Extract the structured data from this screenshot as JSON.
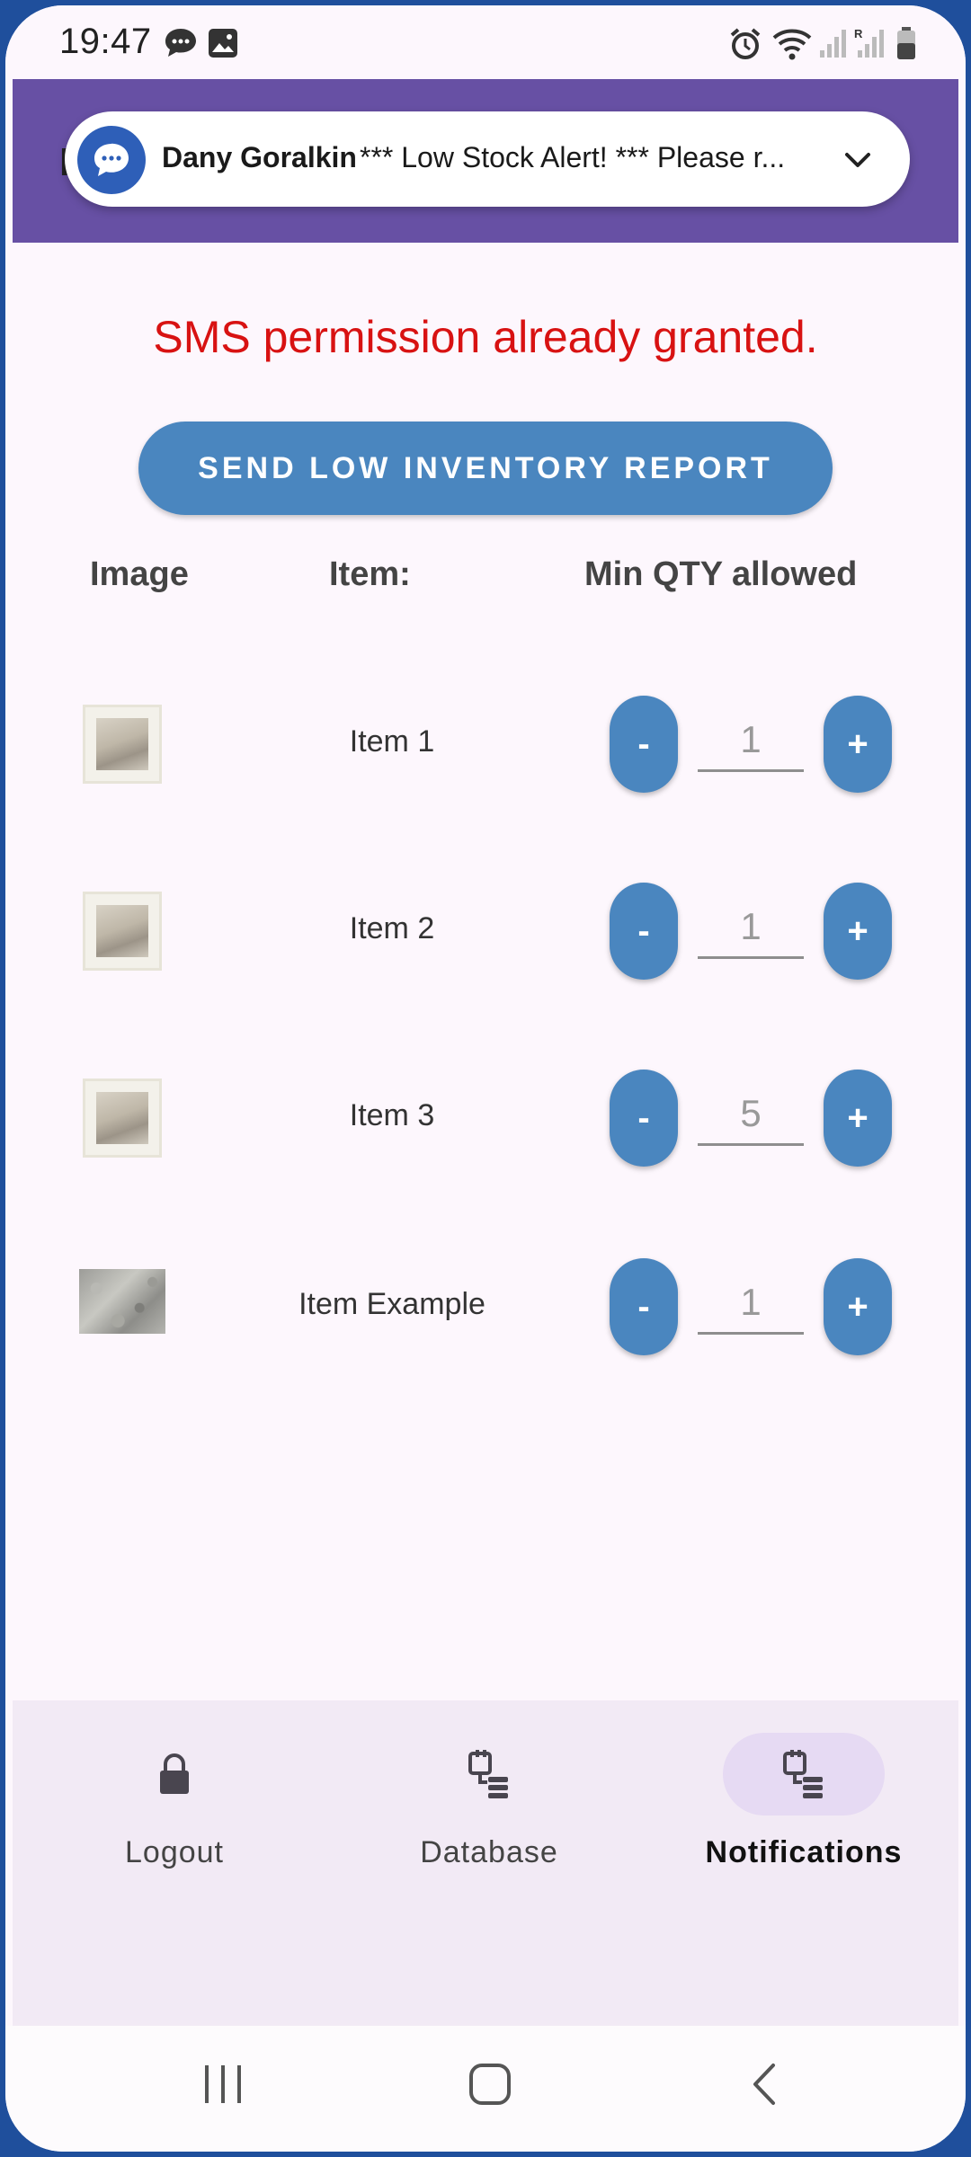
{
  "status_bar": {
    "time": "19:47",
    "icons": [
      "chat-icon",
      "gallery-icon",
      "alarm-icon",
      "wifi-icon",
      "signal-icon",
      "roaming-signal-icon",
      "battery-icon"
    ]
  },
  "app_bar": {
    "title_fragment": "N"
  },
  "notification": {
    "sender": "Dany Goralkin",
    "text": "*** Low Stock Alert! *** Please r...",
    "icon": "message-bubble-icon",
    "expand_icon": "chevron-down-icon"
  },
  "main": {
    "permission_message": "SMS permission already granted.",
    "send_report_label": "SEND LOW INVENTORY REPORT",
    "headers": {
      "image": "Image",
      "item": "Item:",
      "min_qty": "Min QTY allowed"
    },
    "items": [
      {
        "name": "Item 1",
        "qty": "1",
        "image": "framed-photo-thumbnail"
      },
      {
        "name": "Item 2",
        "qty": "1",
        "image": "framed-photo-thumbnail"
      },
      {
        "name": "Item 3",
        "qty": "5",
        "image": "framed-photo-thumbnail"
      },
      {
        "name": "Item Example",
        "qty": "1",
        "image": "stone-texture-thumbnail"
      }
    ],
    "minus_label": "-",
    "plus_label": "+"
  },
  "bottom_nav": {
    "items": [
      {
        "label": "Logout",
        "icon": "lock-icon",
        "active": false
      },
      {
        "label": "Database",
        "icon": "database-icon",
        "active": false
      },
      {
        "label": "Notifications",
        "icon": "database-icon",
        "active": true
      }
    ]
  },
  "system_nav": {
    "icons": [
      "recents-icon",
      "home-icon",
      "back-icon"
    ]
  },
  "colors": {
    "app_bar": "#6750a4",
    "accent_button": "#4a86bf",
    "error_text": "#d81212",
    "nav_background": "#f2eaf5",
    "nav_active_pill": "#e6daf3"
  }
}
